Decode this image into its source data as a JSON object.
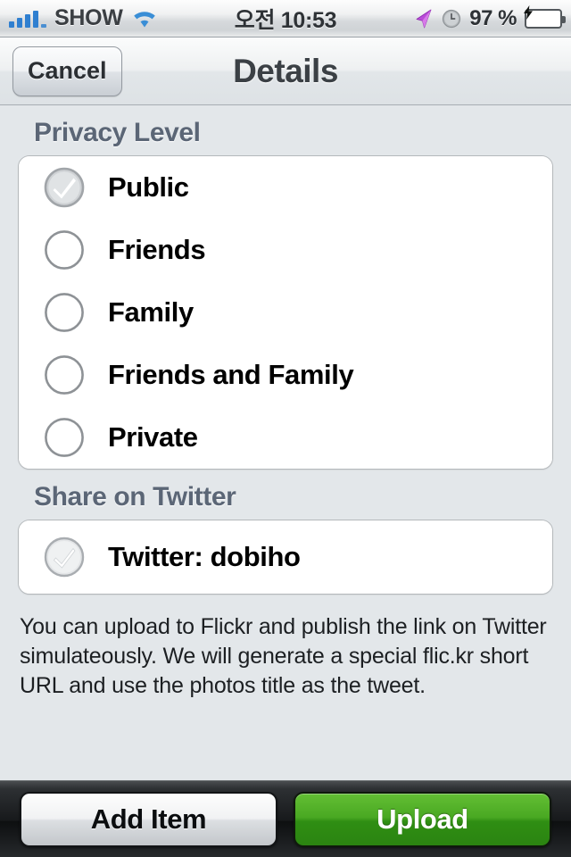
{
  "status_bar": {
    "carrier": "SHOW",
    "signal_icon": "signal-bars-icon",
    "wifi_icon": "wifi-icon",
    "time": "오전 10:53",
    "location_icon": "location-arrow-icon",
    "alarm_icon": "alarm-clock-icon",
    "battery_percent": "97 %",
    "battery_icon": "battery-charging-icon"
  },
  "nav_bar": {
    "cancel_label": "Cancel",
    "title": "Details"
  },
  "privacy": {
    "header": "Privacy Level",
    "options": [
      {
        "label": "Public",
        "selected": true
      },
      {
        "label": "Friends",
        "selected": false
      },
      {
        "label": "Family",
        "selected": false
      },
      {
        "label": "Friends and Family",
        "selected": false
      },
      {
        "label": "Private",
        "selected": false
      }
    ]
  },
  "twitter": {
    "header": "Share on Twitter",
    "option": {
      "label": "Twitter: dobiho",
      "selected": true
    },
    "note": "You can upload to Flickr and publish the link on Twitter simulateously. We will generate a special flic.kr short URL and use the photos title as the tweet."
  },
  "toolbar": {
    "add_item_label": "Add Item",
    "upload_label": "Upload"
  },
  "colors": {
    "background": "#e3e7ea",
    "section_header_text": "#5b6676",
    "signal_blue": "#2f7fd0",
    "location_purple": "#b94bd8",
    "battery_green": "#5cb82c",
    "upload_green": "#3f9c18",
    "toolbar_dark": "#17191b"
  }
}
